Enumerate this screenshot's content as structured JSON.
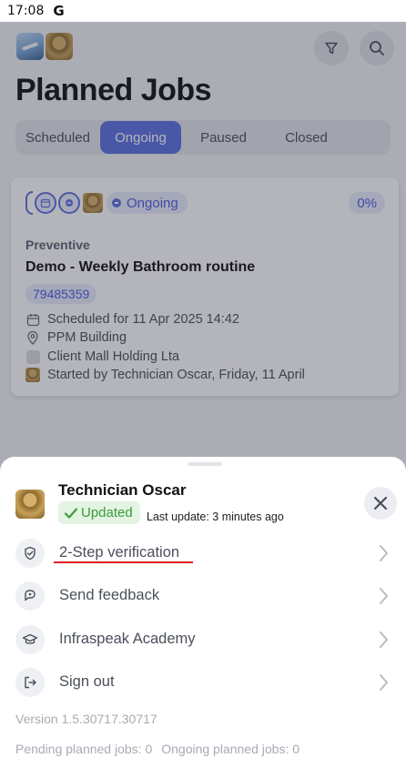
{
  "status_bar": {
    "time": "17:08",
    "google_glyph": "G"
  },
  "header": {
    "title": "Planned Jobs"
  },
  "tabs": [
    {
      "label": "Scheduled",
      "active": false
    },
    {
      "label": "Ongoing",
      "active": true
    },
    {
      "label": "Paused",
      "active": false
    },
    {
      "label": "Closed",
      "active": false
    }
  ],
  "job_card": {
    "status": "Ongoing",
    "progress": "0%",
    "type": "Preventive",
    "title": "Demo - Weekly Bathroom routine",
    "id": "79485359",
    "scheduled": "Scheduled for 11 Apr 2025 14:42",
    "location": "PPM Building",
    "client": "Client Mall Holding Lta",
    "started_by": "Started by Technician Oscar, Friday, 11 April"
  },
  "profile_sheet": {
    "user_name": "Technician Oscar",
    "sync_status": "Updated",
    "last_update": "Last update: 3 minutes ago",
    "menu": [
      {
        "label": "2-Step verification",
        "icon": "shield-check-icon"
      },
      {
        "label": "Send feedback",
        "icon": "feedback-icon"
      },
      {
        "label": "Infraspeak Academy",
        "icon": "graduation-cap-icon"
      },
      {
        "label": "Sign out",
        "icon": "sign-out-icon"
      }
    ],
    "version": "Version 1.5.30717.30717",
    "pending_jobs": "Pending planned jobs: 0",
    "ongoing_jobs": "Ongoing planned jobs: 0"
  },
  "colors": {
    "accent": "#5b6fe0",
    "accent_light": "#e8ebfb",
    "success": "#3a9a3a",
    "success_bg": "#e3f4e3",
    "annotation_underline": "#e02020"
  }
}
